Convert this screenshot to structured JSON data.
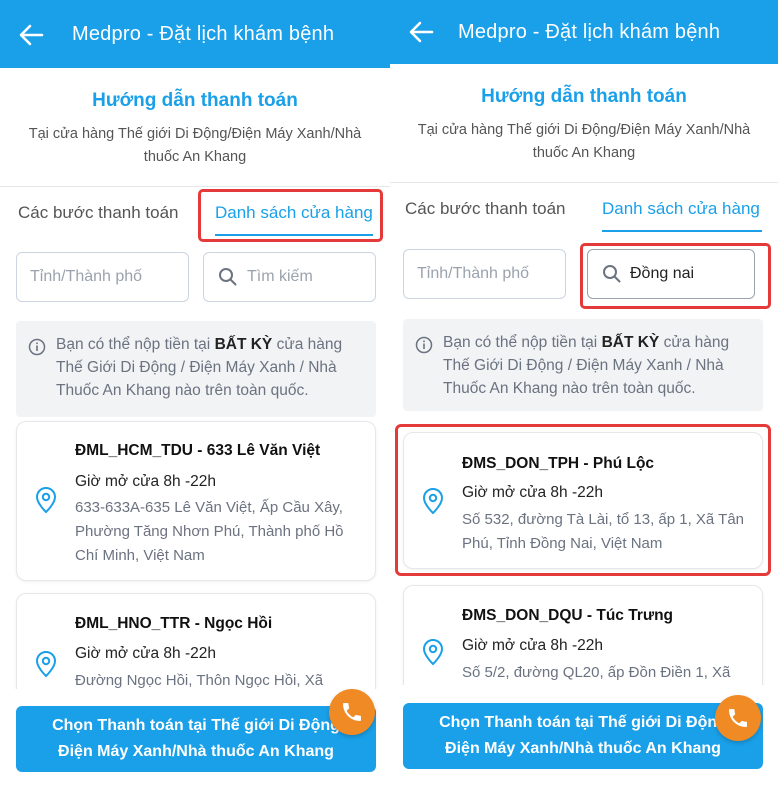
{
  "header": {
    "title": "Medpro - Đặt lịch khám bệnh"
  },
  "guide": {
    "title": "Hướng dẫn thanh toán",
    "subtitle_line1": "Tại cửa hàng Thế giới Di Động/Điện Máy Xanh/Nhà",
    "subtitle_line2": "thuốc An Khang"
  },
  "tabs": {
    "steps": "Các bước thanh toán",
    "stores": "Danh sách cửa hàng"
  },
  "filters": {
    "province_placeholder": "Tỉnh/Thành phố",
    "search_placeholder": "Tìm kiếm",
    "search_value_right": "Đồng nai"
  },
  "notice": {
    "pre": "Bạn có thể nộp tiền tại ",
    "bold": "BẤT KỲ",
    "post_line1": " cửa hàng",
    "line2": "Thế Giới Di Động / Điện Máy Xanh / Nhà",
    "line3": "Thuốc An Khang nào trên toàn quốc."
  },
  "left_stores": [
    {
      "name": "ĐML_HCM_TDU - 633 Lê Văn Việt",
      "hours": "Giờ mở cửa 8h -22h",
      "addr_l1": "633-633A-635 Lê Văn Việt, Ấp Cầu Xây,",
      "addr_l2": "Phường Tăng Nhơn Phú, Thành phố Hồ",
      "addr_l3": "Chí Minh, Việt Nam"
    },
    {
      "name": "ĐML_HNO_TTR - Ngọc Hồi",
      "hours": "Giờ mở cửa 8h -22h",
      "addr_l1": "Đường Ngọc Hồi, Thôn Ngọc Hồi, Xã"
    }
  ],
  "right_stores": [
    {
      "name": "ĐMS_DON_TPH - Phú Lộc",
      "hours": "Giờ mở cửa 8h -22h",
      "addr_l1": "Số 532, đường Tà Lài, tổ 13, ấp 1, Xã Tân",
      "addr_l2": "Phú, Tỉnh Đồng Nai, Việt Nam"
    },
    {
      "name": "ĐMS_DON_DQU - Túc Trưng",
      "hours": "Giờ mở cửa 8h -22h",
      "addr_l1": "Số 5/2, đường QL20, ấp Đồn Điền 1, Xã"
    }
  ],
  "cta": {
    "line1": "Chọn Thanh toán tại Thế giới Di Động",
    "line2": "Điện Máy Xanh/Nhà thuốc An Khang"
  },
  "colors": {
    "brand": "#1aa0e9",
    "highlight": "#e53a3a",
    "call": "#f08a24"
  }
}
